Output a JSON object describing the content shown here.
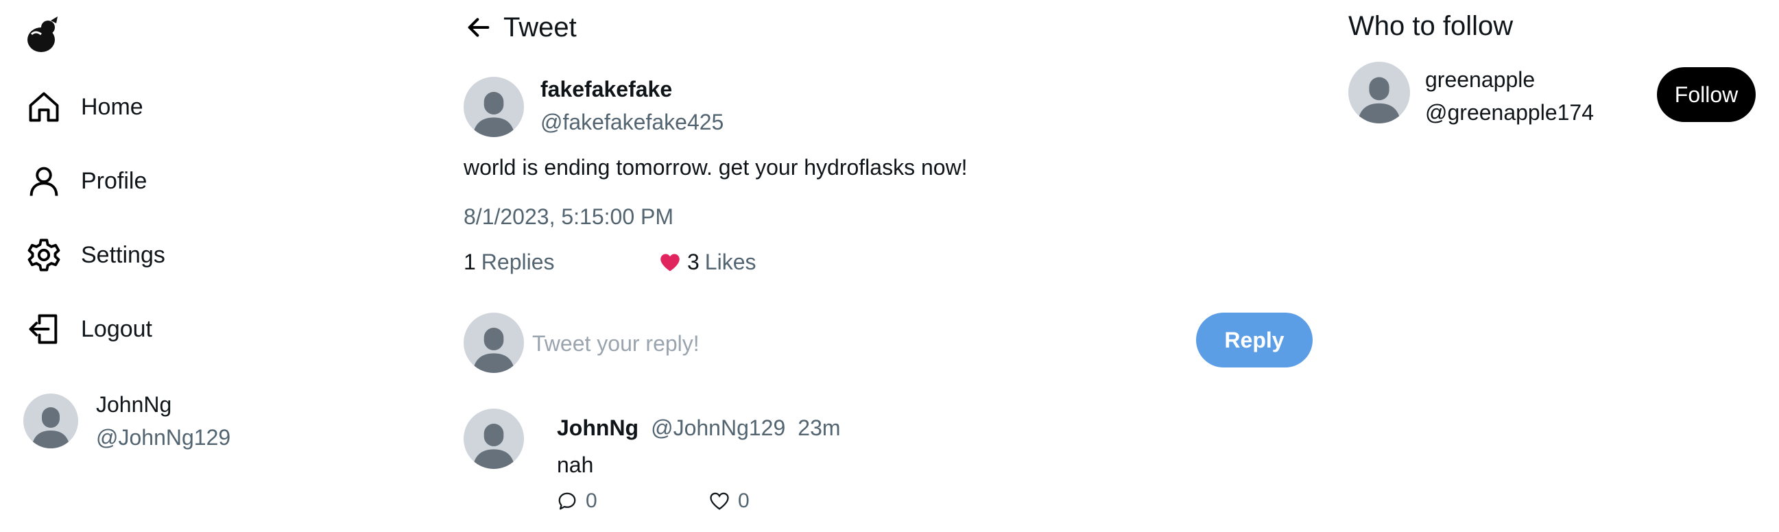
{
  "sidebar": {
    "logo": "pear-bird-logo",
    "items": [
      {
        "label": "Home",
        "icon": "home-icon"
      },
      {
        "label": "Profile",
        "icon": "user-icon"
      },
      {
        "label": "Settings",
        "icon": "gear-icon"
      },
      {
        "label": "Logout",
        "icon": "logout-icon"
      }
    ],
    "current_user": {
      "name": "JohnNg",
      "handle": "@JohnNg129"
    }
  },
  "header": {
    "title": "Tweet"
  },
  "tweet": {
    "author_name": "fakefakefake",
    "author_handle": "@fakefakefake425",
    "text": "world is ending tomorrow. get your hydroflasks now!",
    "date": "8/1/2023, 5:15:00 PM",
    "replies_count": "1",
    "replies_label": "Replies",
    "likes_count": "3",
    "likes_label": "Likes",
    "liked": true
  },
  "reply_box": {
    "placeholder": "Tweet your reply!",
    "button_label": "Reply"
  },
  "replies": [
    {
      "name": "JohnNg",
      "handle": "@JohnNg129",
      "time": "23m",
      "text": "nah",
      "comments": "0",
      "likes": "0"
    }
  ],
  "who_to_follow": {
    "title": "Who to follow",
    "users": [
      {
        "name": "greenapple",
        "handle": "@greenapple174",
        "button_label": "Follow"
      }
    ]
  },
  "colors": {
    "accent": "#5c9ee6",
    "like": "#e0245e",
    "muted": "#536471",
    "avatar_bg": "#cfd5db",
    "avatar_fg": "#67717c"
  }
}
